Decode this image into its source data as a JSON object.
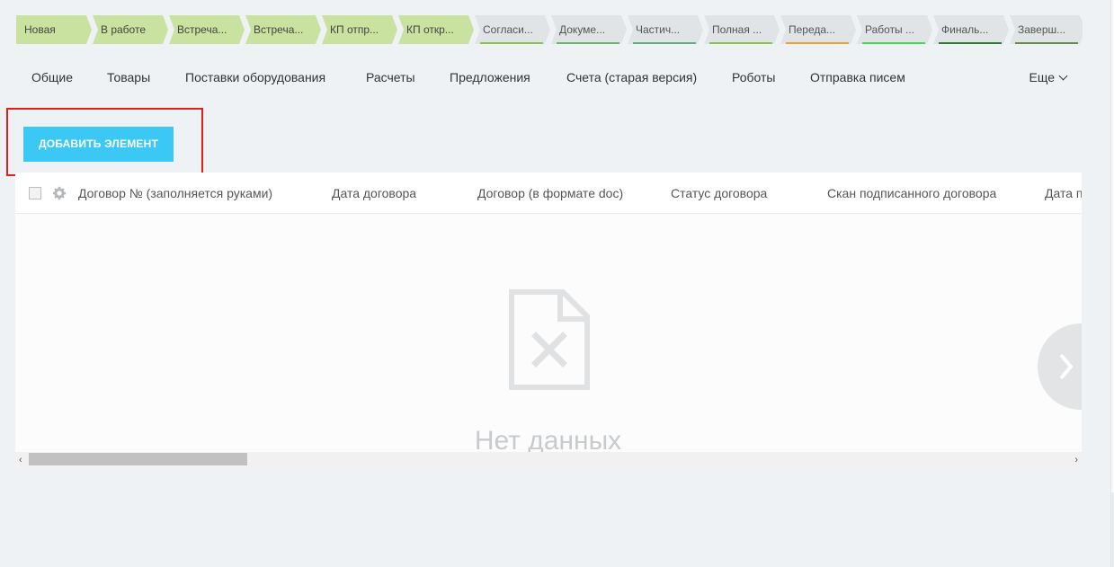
{
  "stages": [
    {
      "label": "Новая",
      "state": "done",
      "bar": ""
    },
    {
      "label": "В работе",
      "state": "done",
      "bar": ""
    },
    {
      "label": "Встреча...",
      "state": "done",
      "bar": ""
    },
    {
      "label": "Встреча...",
      "state": "done",
      "bar": ""
    },
    {
      "label": "КП отпр...",
      "state": "done",
      "bar": ""
    },
    {
      "label": "КП откр...",
      "state": "done",
      "bar": ""
    },
    {
      "label": "Согласи...",
      "state": "todo",
      "bar": "#8bc34a"
    },
    {
      "label": "Докуме...",
      "state": "todo",
      "bar": "#6bb56b"
    },
    {
      "label": "Частич...",
      "state": "todo",
      "bar": "#58b47a"
    },
    {
      "label": "Полная ...",
      "state": "todo",
      "bar": "#8bc34a"
    },
    {
      "label": "Переда...",
      "state": "todo",
      "bar": "#f0a030"
    },
    {
      "label": "Работы ...",
      "state": "todo",
      "bar": "#47d94b"
    },
    {
      "label": "Финаль...",
      "state": "todo",
      "bar": "#2e7d32"
    },
    {
      "label": "Заверш...",
      "state": "todo",
      "bar": "#6a8c4a"
    }
  ],
  "tabs": [
    "Общие",
    "Товары",
    "Поставки оборудования",
    "Расчеты",
    "Предложения",
    "Счета (старая версия)",
    "Роботы",
    "Отправка писем"
  ],
  "tabs_more": "Еще",
  "add_button": "ДОБАВИТЬ ЭЛЕМЕНТ",
  "columns": [
    "Договор № (заполняется руками)",
    "Дата договора",
    "Договор (в формате doc)",
    "Статус договора",
    "Скан подписанного договора",
    "Дата п"
  ],
  "empty_text": "Нет данных",
  "icons": {
    "settings": "gear-icon",
    "empty": "file-x-icon",
    "next": "chevron-right-icon"
  }
}
